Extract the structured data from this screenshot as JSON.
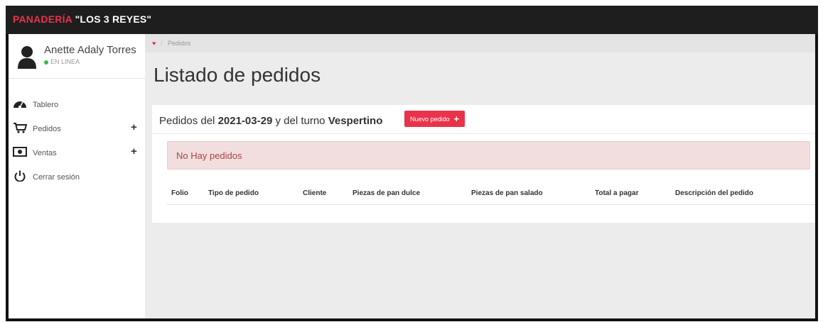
{
  "brand": {
    "part1": "PANADERÍA",
    "part2": "\"LOS 3 REYES\"",
    "color": "#e8334a"
  },
  "user": {
    "name": "Anette Adaly Torres",
    "status": "EN LINEA",
    "status_color": "#3cb54a"
  },
  "menu": [
    {
      "label": "Tablero",
      "icon": "dashboard-icon",
      "expandable": false
    },
    {
      "label": "Pedidos",
      "icon": "cart-icon",
      "expandable": true,
      "expander": "+"
    },
    {
      "label": "Ventas",
      "icon": "money-icon",
      "expandable": true,
      "expander": "+"
    },
    {
      "label": "Cerrar sesión",
      "icon": "power-icon",
      "expandable": false
    }
  ],
  "breadcrumb": {
    "home_icon": "home-icon",
    "separator": "/",
    "current": "Pedidos"
  },
  "page": {
    "title": "Listado de pedidos"
  },
  "panel": {
    "prefix": "Pedidos del ",
    "date": "2021-03-29",
    "middle": " y del turno ",
    "shift": "Vespertino",
    "new_button": "Nuevo pedido",
    "new_button_icon": "+"
  },
  "alert": {
    "message": "No Hay pedidos"
  },
  "table": {
    "columns": [
      "Folio",
      "Tipo de pedido",
      "Cliente",
      "Piezas de pan dulce",
      "Piezas de pan salado",
      "Total a pagar",
      "Descripción del pedido"
    ],
    "rows": []
  },
  "colors": {
    "accent": "#e8334a",
    "topbar": "#1e1e1e",
    "alert_bg": "#f2dede",
    "alert_text": "#a94442"
  }
}
